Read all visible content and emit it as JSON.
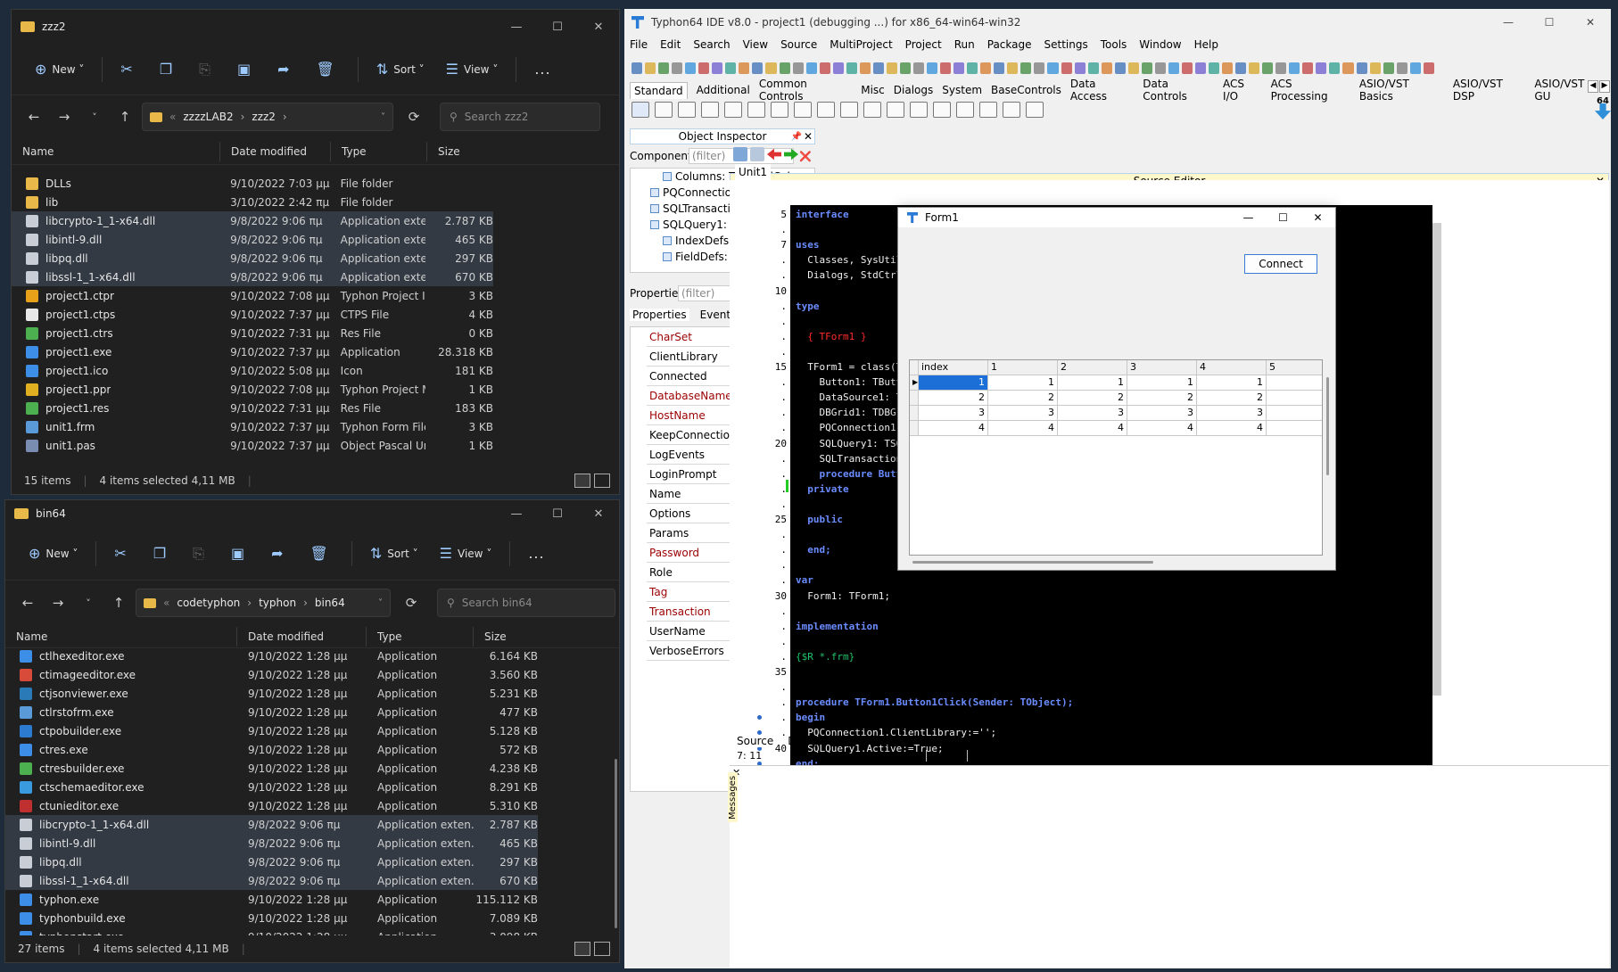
{
  "explorer1": {
    "title": "zzz2",
    "cmd": {
      "new": "New",
      "sort": "Sort",
      "view": "View",
      "more": "..."
    },
    "breadcrumb": [
      "zzzzLAB2",
      "zzz2"
    ],
    "search_placeholder": "Search zzz2",
    "columns": [
      "Name",
      "Date modified",
      "Type",
      "Size"
    ],
    "files": [
      {
        "name": "DLLs",
        "date": "9/10/2022 7:03 μμ",
        "type": "File folder",
        "size": "",
        "icon": "folder",
        "selected": false
      },
      {
        "name": "lib",
        "date": "3/10/2022 2:42 πμ",
        "type": "File folder",
        "size": "",
        "icon": "folder",
        "selected": false
      },
      {
        "name": "libcrypto-1_1-x64.dll",
        "date": "9/8/2022 9:06 πμ",
        "type": "Application exten...",
        "size": "2.787 KB",
        "icon": "dll",
        "selected": true
      },
      {
        "name": "libintl-9.dll",
        "date": "9/8/2022 9:06 πμ",
        "type": "Application exten...",
        "size": "465 KB",
        "icon": "dll",
        "selected": true
      },
      {
        "name": "libpq.dll",
        "date": "9/8/2022 9:06 πμ",
        "type": "Application exten...",
        "size": "297 KB",
        "icon": "dll",
        "selected": true
      },
      {
        "name": "libssl-1_1-x64.dll",
        "date": "9/8/2022 9:06 πμ",
        "type": "Application exten...",
        "size": "670 KB",
        "icon": "dll",
        "selected": true
      },
      {
        "name": "project1.ctpr",
        "date": "9/10/2022 7:08 μμ",
        "type": "Typhon Project Inf...",
        "size": "3 KB",
        "icon": "ctpr",
        "selected": false
      },
      {
        "name": "project1.ctps",
        "date": "9/10/2022 7:37 μμ",
        "type": "CTPS File",
        "size": "4 KB",
        "icon": "blank",
        "selected": false
      },
      {
        "name": "project1.ctrs",
        "date": "9/10/2022 7:31 μμ",
        "type": "Res File",
        "size": "0 KB",
        "icon": "res",
        "selected": false
      },
      {
        "name": "project1.exe",
        "date": "9/10/2022 7:37 μμ",
        "type": "Application",
        "size": "28.318 KB",
        "icon": "exe",
        "selected": false
      },
      {
        "name": "project1.ico",
        "date": "9/10/2022 5:08 μμ",
        "type": "Icon",
        "size": "181 KB",
        "icon": "exe",
        "selected": false
      },
      {
        "name": "project1.ppr",
        "date": "9/10/2022 7:08 μμ",
        "type": "Typhon Project M...",
        "size": "1 KB",
        "icon": "ppr",
        "selected": false
      },
      {
        "name": "project1.res",
        "date": "9/10/2022 7:31 μμ",
        "type": "Res File",
        "size": "183 KB",
        "icon": "res",
        "selected": false
      },
      {
        "name": "unit1.frm",
        "date": "9/10/2022 7:37 μμ",
        "type": "Typhon Form File",
        "size": "3 KB",
        "icon": "frm",
        "selected": false
      },
      {
        "name": "unit1.pas",
        "date": "9/10/2022 7:37 μμ",
        "type": "Object Pascal Unit",
        "size": "1 KB",
        "icon": "pas",
        "selected": false
      }
    ],
    "status": {
      "items": "15 items",
      "selected": "4 items selected  4,11 MB"
    }
  },
  "explorer2": {
    "title": "bin64",
    "cmd": {
      "new": "New",
      "sort": "Sort",
      "view": "View",
      "more": "..."
    },
    "breadcrumb": [
      "codetyphon",
      "typhon",
      "bin64"
    ],
    "search_placeholder": "Search bin64",
    "columns": [
      "Name",
      "Date modified",
      "Type",
      "Size"
    ],
    "files": [
      {
        "name": "ctlhexeditor.exe",
        "date": "9/10/2022 1:28 μμ",
        "type": "Application",
        "size": "6.164 KB",
        "icon": "exe",
        "selected": false
      },
      {
        "name": "ctimageeditor.exe",
        "date": "9/10/2022 1:28 μμ",
        "type": "Application",
        "size": "3.560 KB",
        "icon": "img",
        "selected": false
      },
      {
        "name": "ctjsonviewer.exe",
        "date": "9/10/2022 1:28 μμ",
        "type": "Application",
        "size": "5.231 KB",
        "icon": "json",
        "selected": false
      },
      {
        "name": "ctlrstofrm.exe",
        "date": "9/10/2022 1:28 μμ",
        "type": "Application",
        "size": "477 KB",
        "icon": "frm",
        "selected": false
      },
      {
        "name": "ctpobuilder.exe",
        "date": "9/10/2022 1:28 μμ",
        "type": "Application",
        "size": "5.128 KB",
        "icon": "po",
        "selected": false
      },
      {
        "name": "ctres.exe",
        "date": "9/10/2022 1:28 μμ",
        "type": "Application",
        "size": "572 KB",
        "icon": "exe",
        "selected": false
      },
      {
        "name": "ctresbuilder.exe",
        "date": "9/10/2022 1:28 μμ",
        "type": "Application",
        "size": "4.238 KB",
        "icon": "res",
        "selected": false
      },
      {
        "name": "ctschemaeditor.exe",
        "date": "9/10/2022 1:28 μμ",
        "type": "Application",
        "size": "8.291 KB",
        "icon": "schema",
        "selected": false
      },
      {
        "name": "ctunieditor.exe",
        "date": "9/10/2022 1:28 μμ",
        "type": "Application",
        "size": "5.310 KB",
        "icon": "uni",
        "selected": false
      },
      {
        "name": "libcrypto-1_1-x64.dll",
        "date": "9/8/2022 9:06 πμ",
        "type": "Application exten...",
        "size": "2.787 KB",
        "icon": "dll",
        "selected": true
      },
      {
        "name": "libintl-9.dll",
        "date": "9/8/2022 9:06 πμ",
        "type": "Application exten...",
        "size": "465 KB",
        "icon": "dll",
        "selected": true
      },
      {
        "name": "libpq.dll",
        "date": "9/8/2022 9:06 πμ",
        "type": "Application exten...",
        "size": "297 KB",
        "icon": "dll",
        "selected": true
      },
      {
        "name": "libssl-1_1-x64.dll",
        "date": "9/8/2022 9:06 πμ",
        "type": "Application exten...",
        "size": "670 KB",
        "icon": "dll",
        "selected": true
      },
      {
        "name": "typhon.exe",
        "date": "9/10/2022 1:28 μμ",
        "type": "Application",
        "size": "115.112 KB",
        "icon": "exe",
        "selected": false
      },
      {
        "name": "typhonbuild.exe",
        "date": "9/10/2022 1:28 μμ",
        "type": "Application",
        "size": "7.089 KB",
        "icon": "exe",
        "selected": false
      },
      {
        "name": "typhonstart.exe",
        "date": "9/10/2022 1:28 μμ",
        "type": "Application",
        "size": "3.098 KB",
        "icon": "exe",
        "selected": false
      }
    ],
    "status": {
      "items": "27 items",
      "selected": "4 items selected  4,11 MB"
    }
  },
  "ide": {
    "title": "Typhon64 IDE v8.0 - project1 (debugging ...) for x86_64-win64-win32",
    "menu": [
      "File",
      "Edit",
      "Search",
      "View",
      "Source",
      "MultiProject",
      "Project",
      "Run",
      "Package",
      "Settings",
      "Tools",
      "Window",
      "Help"
    ],
    "palette_tabs": [
      "Standard",
      "Additional",
      "Common Controls",
      "Misc",
      "Dialogs",
      "System",
      "BaseControls",
      "Data Access",
      "Data Controls",
      "ACS I/O",
      "ACS Processing",
      "ASIO/VST Basics",
      "ASIO/VST DSP",
      "ASIO/VST GU"
    ],
    "palette_badge": "64",
    "object_inspector": {
      "title": "Object Inspector",
      "components_label": "Components",
      "filter_placeholder": "(filter)",
      "tree": [
        "Columns: TDBGridColumns",
        "PQConnection1: TPQConnectio",
        "SQLTransaction1: TSQLTransacti",
        "SQLQuery1: TSQLQuery",
        "IndexDefs: TCustomBufDatas",
        "FieldDefs: TSQLDBFieldDefs"
      ],
      "properties_label": "Properties",
      "tabs": [
        "Properties",
        "Events",
        "Favorites",
        "Restricted"
      ],
      "props": [
        {
          "name": "CharSet",
          "value": "UTF8",
          "red": true,
          "check": ""
        },
        {
          "name": "ClientLibrary",
          "value": "",
          "red": false,
          "check": ""
        },
        {
          "name": "Connected",
          "value": "(True)",
          "red": false,
          "check": "on"
        },
        {
          "name": "DatabaseName",
          "value": "demo",
          "red": true,
          "check": ""
        },
        {
          "name": "HostName",
          "value": "localhost",
          "red": true,
          "check": ""
        },
        {
          "name": "KeepConnection",
          "value": "(True)",
          "red": false,
          "check": "on"
        },
        {
          "name": "LogEvents",
          "value": "[detCustom,det",
          "red": false,
          "check": ""
        },
        {
          "name": "LoginPrompt",
          "value": "(False)",
          "red": false,
          "check": "off"
        },
        {
          "name": "Name",
          "value": "PQConnection1",
          "red": false,
          "check": ""
        },
        {
          "name": "Options",
          "value": "[]",
          "red": false,
          "check": ""
        },
        {
          "name": "Params",
          "value": "(TStrings)",
          "red": false,
          "check": ""
        },
        {
          "name": "Password",
          "value": "*****",
          "red": true,
          "check": ""
        },
        {
          "name": "Role",
          "value": "",
          "red": false,
          "check": ""
        },
        {
          "name": "Tag",
          "value": "0",
          "red": true,
          "check": ""
        },
        {
          "name": "Transaction",
          "value": "SQLTransaction",
          "red": true,
          "check": ""
        },
        {
          "name": "UserName",
          "value": "",
          "red": false,
          "check": ""
        },
        {
          "name": "VerboseErrors",
          "value": "(True)",
          "red": false,
          "check": "on"
        }
      ]
    },
    "source_editor": {
      "title": "Source Editor",
      "tab": "Unit1",
      "bottom_tabs": [
        "Source",
        "Designer"
      ],
      "status": {
        "pos": "7: 11",
        "mode": "INS",
        "file": "D:\\zzzzLAB2\\zzz2\\unit1.pas"
      },
      "messages_label": "Messages"
    }
  },
  "form1": {
    "title": "Form1",
    "button": "Connect",
    "grid_headers": [
      "index",
      "1",
      "2",
      "3",
      "4",
      "5"
    ],
    "grid_rows": [
      [
        "1",
        "1",
        "1",
        "1",
        "1",
        "1"
      ],
      [
        "2",
        "2",
        "2",
        "2",
        "2",
        "2"
      ],
      [
        "3",
        "3",
        "3",
        "3",
        "3",
        "3"
      ],
      [
        "4",
        "4",
        "4",
        "4",
        "4",
        "4"
      ]
    ]
  },
  "code_lines": [
    {
      "n": "5",
      "t": "interface",
      "k": "kw"
    },
    {
      "n": ".",
      "t": "",
      "k": ""
    },
    {
      "n": "7",
      "t": "uses",
      "k": "kw"
    },
    {
      "n": ".",
      "t": "  Classes, SysUtils, PQ",
      "k": "id"
    },
    {
      "n": ".",
      "t": "  Dialogs, StdCtrls, DB",
      "k": "id"
    },
    {
      "n": "10",
      "t": "",
      "k": ""
    },
    {
      "n": ".",
      "t": "type",
      "k": "kw"
    },
    {
      "n": ".",
      "t": "",
      "k": ""
    },
    {
      "n": ".",
      "t": "  { TForm1 }",
      "k": "cm"
    },
    {
      "n": ".",
      "t": "",
      "k": ""
    },
    {
      "n": "15",
      "t": "  TForm1 = class(TForm)",
      "k": "id"
    },
    {
      "n": ".",
      "t": "    Button1: TButton;",
      "k": "id"
    },
    {
      "n": ".",
      "t": "    DataSource1: TDataS",
      "k": "id"
    },
    {
      "n": ".",
      "t": "    DBGrid1: TDBGrid;",
      "k": "id"
    },
    {
      "n": ".",
      "t": "    PQConnection1: TPQC",
      "k": "id"
    },
    {
      "n": "20",
      "t": "    SQLQuery1: TSQLQuer",
      "k": "id"
    },
    {
      "n": ".",
      "t": "    SQLTransaction1: TS",
      "k": "id"
    },
    {
      "n": ".",
      "t": "    procedure Button1Cl",
      "k": "kw"
    },
    {
      "n": ".",
      "t": "  private",
      "k": "kw"
    },
    {
      "n": ".",
      "t": "",
      "k": ""
    },
    {
      "n": "25",
      "t": "  public",
      "k": "kw"
    },
    {
      "n": ".",
      "t": "",
      "k": ""
    },
    {
      "n": ".",
      "t": "  end;",
      "k": "kw"
    },
    {
      "n": ".",
      "t": "",
      "k": ""
    },
    {
      "n": ".",
      "t": "var",
      "k": "kw"
    },
    {
      "n": "30",
      "t": "  Form1: TForm1;",
      "k": "id"
    },
    {
      "n": ".",
      "t": "",
      "k": ""
    },
    {
      "n": ".",
      "t": "implementation",
      "k": "kw"
    },
    {
      "n": ".",
      "t": "",
      "k": ""
    },
    {
      "n": ".",
      "t": "{$R *.frm}",
      "k": "dir"
    },
    {
      "n": "35",
      "t": "",
      "k": ""
    },
    {
      "n": ".",
      "t": "",
      "k": ""
    },
    {
      "n": ".",
      "t": "procedure TForm1.Button1Click(Sender: TObject);",
      "k": "kw"
    },
    {
      "n": ".",
      "t": "begin",
      "k": "kw"
    },
    {
      "n": ".",
      "t": "  PQConnection1.ClientLibrary:='';",
      "k": "id"
    },
    {
      "n": "40",
      "t": "  SQLQuery1.Active:=True;",
      "k": "id"
    },
    {
      "n": ".",
      "t": "end;",
      "k": "kw"
    },
    {
      "n": ".",
      "t": "",
      "k": ""
    },
    {
      "n": ".",
      "t": "end.",
      "k": "kw"
    },
    {
      "n": "44",
      "t": "",
      "k": ""
    }
  ]
}
